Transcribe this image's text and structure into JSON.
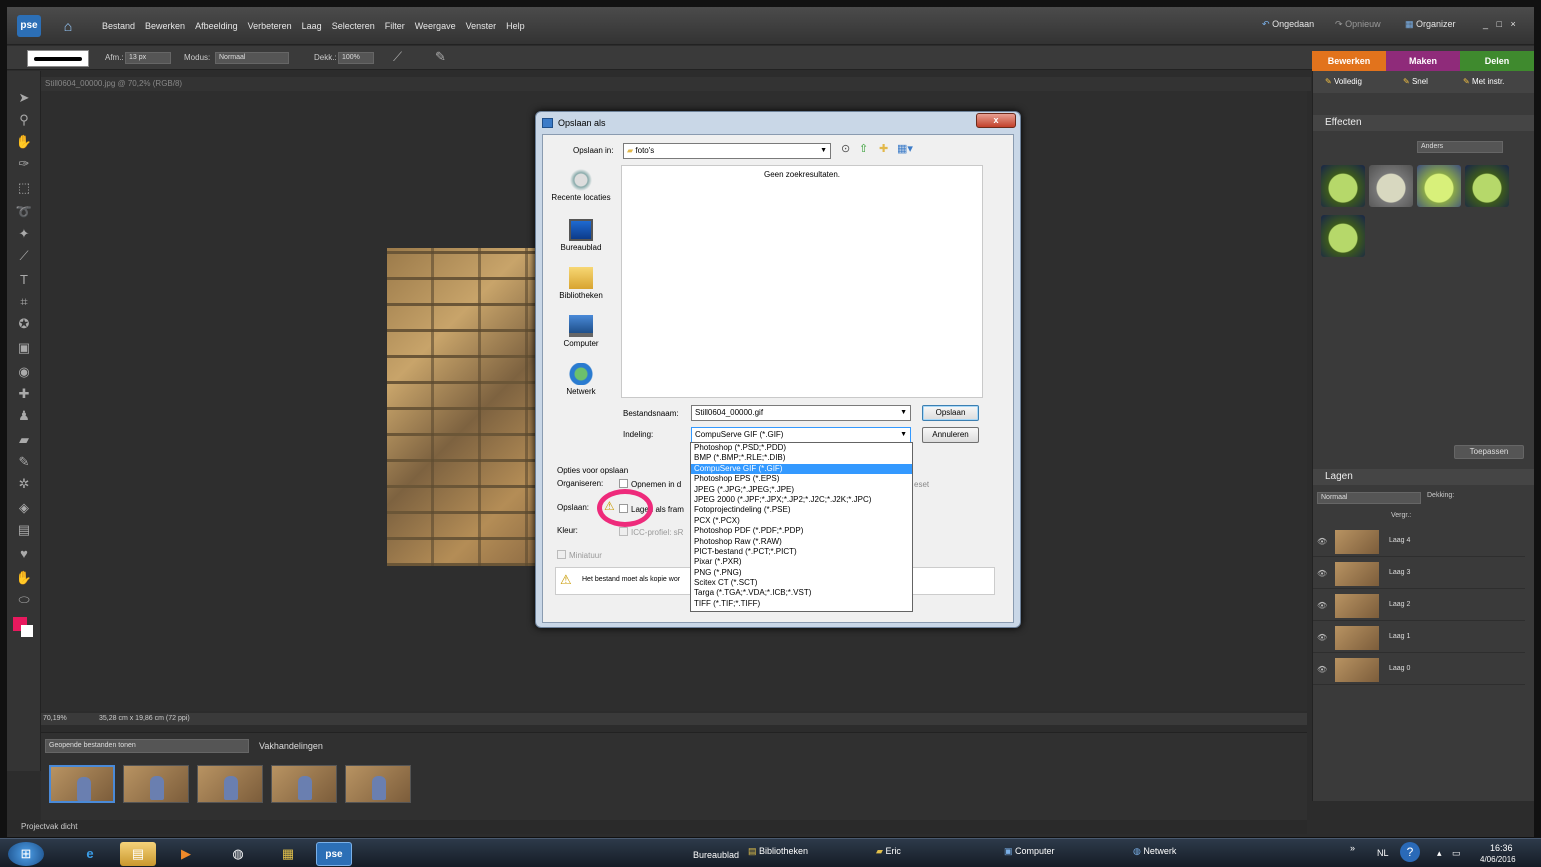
{
  "app": {
    "logo": "pse",
    "menu": [
      "Bestand",
      "Bewerken",
      "Afbeelding",
      "Verbeteren",
      "Laag",
      "Selecteren",
      "Filter",
      "Weergave",
      "Venster",
      "Help"
    ],
    "undo": "Ongedaan",
    "redo": "Opnieuw",
    "organizer": "Organizer",
    "win_controls": "_ □ ×"
  },
  "options": {
    "size_label": "Afm.:",
    "size_value": "13 px",
    "mode_label": "Modus:",
    "mode_value": "Normaal",
    "opacity_label": "Dekk.:",
    "opacity_value": "100%"
  },
  "mode_tabs": [
    "Bewerken",
    "Maken",
    "Delen"
  ],
  "mode_tab_colors": [
    "#e2731c",
    "#8f2b7a",
    "#3f8a2e"
  ],
  "document": {
    "title": "Still0604_00000.jpg @ 70,2% (RGB/8)",
    "zoom": "70,19%",
    "size_info": "35,28 cm x 19,86 cm (72 ppi)"
  },
  "project_bin": {
    "dropdown": "Geopende bestanden tonen",
    "actions": "Vakhandelingen",
    "footer": "Projectvak dicht"
  },
  "right_panel": {
    "views": [
      "Volledig",
      "Snel",
      "Met instr."
    ],
    "effects_title": "Effecten",
    "effects_filter": "Anders",
    "apply_button": "Toepassen",
    "layers_title": "Lagen",
    "blend_mode": "Normaal",
    "opacity_label": "Dekking:",
    "lock_label": "Vergr.:",
    "layers": [
      "Laag 4",
      "Laag 3",
      "Laag 2",
      "Laag 1",
      "Laag 0"
    ]
  },
  "dialog": {
    "title": "Opslaan als",
    "close": "x",
    "save_in_label": "Opslaan in:",
    "save_in_value": "foto's",
    "places": [
      "Recente locaties",
      "Bureaublad",
      "Bibliotheken",
      "Computer",
      "Netwerk"
    ],
    "empty_text": "Geen zoekresultaten.",
    "filename_label": "Bestandsnaam:",
    "filename_value": "Still0604_00000.gif",
    "format_label": "Indeling:",
    "format_value": "CompuServe GIF (*.GIF)",
    "save_button": "Opslaan",
    "cancel_button": "Annuleren",
    "options_title": "Opties voor opslaan",
    "organize_label": "Organiseren:",
    "organize_option": "Opnemen in d",
    "organize_tail": "eset",
    "save_label": "Opslaan:",
    "layers_option": "Lagen als fram",
    "color_label": "Kleur:",
    "icc_option": "ICC-profiel:  sR",
    "thumbnail_option": "Miniatuur",
    "warning_text": "Het bestand moet als kopie wor"
  },
  "format_options": [
    "Photoshop (*.PSD;*.PDD)",
    "BMP (*.BMP;*.RLE;*.DIB)",
    "CompuServe GIF (*.GIF)",
    "Photoshop EPS (*.EPS)",
    "JPEG (*.JPG;*.JPEG;*.JPE)",
    "JPEG 2000 (*.JPF;*.JPX;*.JP2;*.J2C;*.J2K;*.JPC)",
    "Fotoprojectindeling (*.PSE)",
    "PCX (*.PCX)",
    "Photoshop PDF (*.PDF;*.PDP)",
    "Photoshop Raw (*.RAW)",
    "PICT-bestand (*.PCT;*.PICT)",
    "Pixar (*.PXR)",
    "PNG (*.PNG)",
    "Scitex CT (*.SCT)",
    "Targa (*.TGA;*.VDA;*.ICB;*.VST)",
    "TIFF (*.TIF;*.TIFF)"
  ],
  "selected_format_index": 2,
  "taskbar": {
    "buttons": [
      "Bureaublad",
      "Bibliotheken",
      "Eric",
      "Computer",
      "Netwerk"
    ],
    "lang": "NL",
    "time": "16:36",
    "date": "4/06/2016"
  }
}
